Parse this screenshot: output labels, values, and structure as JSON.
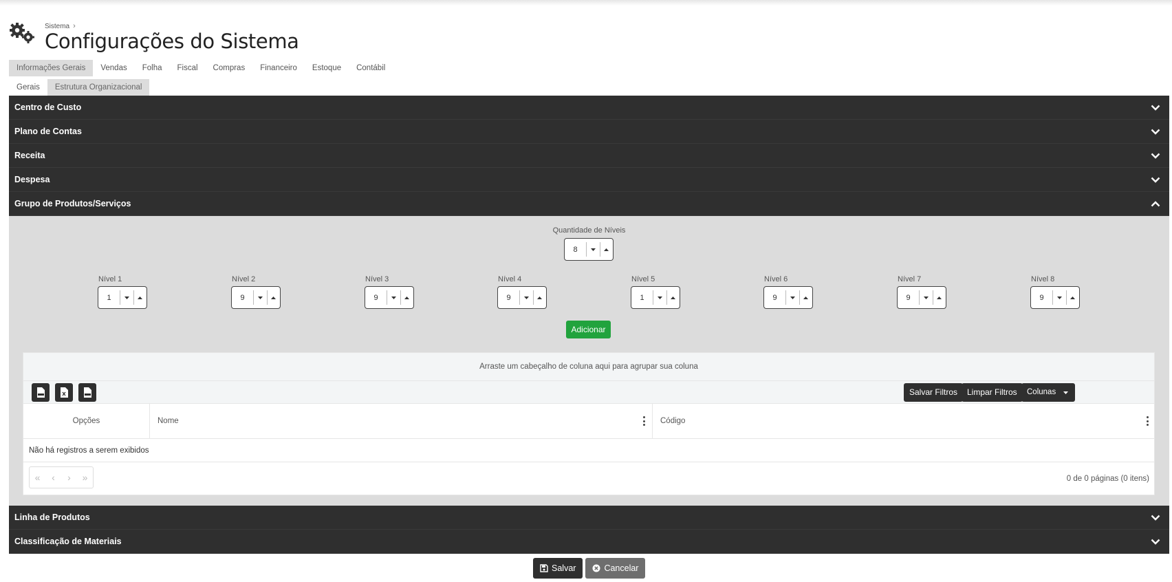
{
  "header": {
    "breadcrumb": "Sistema",
    "title": "Configurações do Sistema"
  },
  "tabs": [
    {
      "label": "Informações Gerais",
      "active": true
    },
    {
      "label": "Vendas"
    },
    {
      "label": "Folha"
    },
    {
      "label": "Fiscal"
    },
    {
      "label": "Compras"
    },
    {
      "label": "Financeiro"
    },
    {
      "label": "Estoque"
    },
    {
      "label": "Contábil"
    }
  ],
  "subtabs": [
    {
      "label": "Gerais"
    },
    {
      "label": "Estrutura Organizacional",
      "active": true
    }
  ],
  "sections": [
    {
      "label": "Centro de Custo",
      "icon": "chevron-down-icon"
    },
    {
      "label": "Plano de Contas",
      "icon": "chevron-down-icon"
    },
    {
      "label": "Receita",
      "icon": "chevron-down-icon"
    },
    {
      "label": "Despesa",
      "icon": "chevron-down-icon"
    },
    {
      "label": "Grupo de Produtos/Serviços",
      "icon": "chevron-up-icon",
      "expanded": true
    },
    {
      "label": "Linha de Produtos",
      "icon": "chevron-down-icon"
    },
    {
      "label": "Classificação de Materiais",
      "icon": "chevron-down-icon"
    }
  ],
  "grupo": {
    "quantidade_label": "Quantidade de Níveis",
    "quantidade_value": "8",
    "levels": [
      {
        "label": "Nível 1",
        "value": "1"
      },
      {
        "label": "Nível 2",
        "value": "9"
      },
      {
        "label": "Nível 3",
        "value": "9"
      },
      {
        "label": "Nível 4",
        "value": "9"
      },
      {
        "label": "Nível 5",
        "value": "1"
      },
      {
        "label": "Nível 6",
        "value": "9"
      },
      {
        "label": "Nível 7",
        "value": "9"
      },
      {
        "label": "Nível 8",
        "value": "9"
      }
    ],
    "add_label": "Adicionar",
    "grid": {
      "group_hint": "Arraste um cabeçalho de coluna aqui para agrupar sua coluna",
      "export_icons": [
        "pdf-export-icon",
        "excel-export-icon",
        "csv-export-icon"
      ],
      "save_filters": "Salvar Filtros",
      "clear_filters": "Limpar Filtros",
      "columns_label": "Colunas",
      "columns": [
        "Opções",
        "Nome",
        "Código"
      ],
      "empty_text": "Não há registros a serem exibidos",
      "pager_buttons": [
        "«",
        "‹",
        "›",
        "»"
      ],
      "pager_info": "0 de 0 páginas (0 itens)"
    }
  },
  "footer": {
    "save": "Salvar",
    "cancel": "Cancelar"
  },
  "colors": {
    "dark": "#2f2f2f",
    "panel": "#dcdcdc",
    "add_green": "#21a33d",
    "cancel_gray": "#6e6e6e"
  }
}
